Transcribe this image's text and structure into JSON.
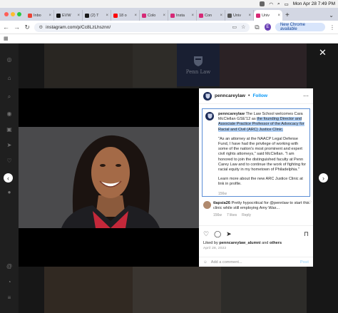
{
  "menubar": {
    "datetime": "Mon Apr 28  7:49 PM"
  },
  "tabs": [
    {
      "label": "Inbo",
      "fav_color": "#ea4335"
    },
    {
      "label": "EVW",
      "fav_color": "#111111"
    },
    {
      "label": "(2) T",
      "fav_color": "#1a1a1a"
    },
    {
      "label": "18 o",
      "fav_color": "#ff0000"
    },
    {
      "label": "Colo",
      "fav_color": "#d62976"
    },
    {
      "label": "Insta",
      "fav_color": "#d62976"
    },
    {
      "label": "Con",
      "fav_color": "#d62976"
    },
    {
      "label": "Univ",
      "fav_color": "#555555"
    },
    {
      "label": "Univ",
      "fav_color": "#d62976",
      "active": true
    }
  ],
  "address_bar": {
    "url": "instagram.com/p/Cc8LzLhsznn/",
    "profile_initial": "E",
    "update_label": "New Chrome available"
  },
  "post": {
    "username": "penncareylaw",
    "follow_label": "Follow",
    "caption_username": "penncareylaw",
    "caption_pre": " The Law School welcomes Cara McClellan GSE'12 as ",
    "caption_highlight": "the founding Director and Associate Practice Professor of the Advocacy for Racial and Civil (ARC) Justice Clinic.",
    "quote": "\"As an attorney at the NAACP Legal Defense Fund, I have had the privilege of working with some of the nation's most prominent and expert civil rights attorneys,\" said McClellan. \"I am honored to join the distinguished faculty at Penn Carey Law and to continue the work of fighting for racial equity in my hometown of Philadelphia.\"",
    "learn_more": "Learn more about the new ARC Justice Clinic at link in profile.",
    "caption_age": "156w",
    "comment": {
      "username": "tlapsia26",
      "text": " Pretty hypocritical for @pennlaw to start this clinic while still employing Amy Wax...",
      "age": "156w",
      "likes": "7 likes",
      "reply": "Reply"
    },
    "liked_by_prefix": "Liked by ",
    "liked_by_user": "penncareylaw_alumni",
    "liked_by_and": " and ",
    "liked_by_others": "others",
    "date": "April 28, 2022",
    "add_comment_placeholder": "Add a comment...",
    "post_label": "Post"
  },
  "background": {
    "penn_text": "Penn Law"
  },
  "icons": [
    "instagram-icon",
    "home-icon",
    "search-icon",
    "explore-icon",
    "reels-icon",
    "messages-icon",
    "heart-icon",
    "create-icon",
    "profile-icon",
    "threads-icon",
    "more-icon",
    "close-icon",
    "chevron-left-icon",
    "chevron-right-icon",
    "comment-icon",
    "share-icon",
    "bookmark-icon",
    "emoji-icon"
  ]
}
